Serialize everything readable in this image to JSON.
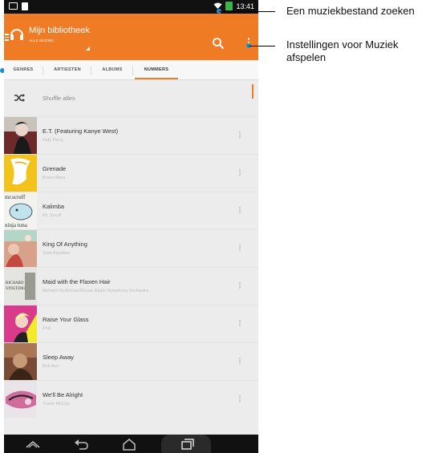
{
  "status_bar": {
    "time": "13:41"
  },
  "action_bar": {
    "title": "Mijn bibliotheek",
    "subtitle": "ALLE MUZIEK"
  },
  "tabs": [
    {
      "label": "GENRES",
      "active": false
    },
    {
      "label": "ARTIESTEN",
      "active": false
    },
    {
      "label": "ALBUMS",
      "active": false
    },
    {
      "label": "NUMMERS",
      "active": true
    }
  ],
  "shuffle": {
    "label": "Shuffle alles"
  },
  "songs": [
    {
      "title": "E.T. (Featuring Kanye West)",
      "artist": "Katy Perry"
    },
    {
      "title": "Grenade",
      "artist": "Bruno Mars"
    },
    {
      "title": "Kalimba",
      "artist": "Mr. Scruff"
    },
    {
      "title": "King Of Anything",
      "artist": "Sara Bareilles"
    },
    {
      "title": "Maid with the Flaxen Hair",
      "artist": "Richard Stoltzman/Slovak Radio Symphony Orchestra"
    },
    {
      "title": "Raise Your Glass",
      "artist": "Pink"
    },
    {
      "title": "Sleep Away",
      "artist": "Bob Acri"
    },
    {
      "title": "We'll Be Alright",
      "artist": "Travie McCoy"
    }
  ],
  "album_art_text": {
    "kalimba_top": "mr.scruff",
    "kalimba_bottom": "ninja tuna",
    "maid_line1": "RICHARD",
    "maid_line2": "STOLTZMAN"
  },
  "callouts": {
    "search": "Een muziekbestand zoeken",
    "settings_line1": "Instellingen voor Muziek",
    "settings_line2": "afspelen"
  },
  "colors": {
    "accent": "#ef7c25",
    "callout_dot": "#1c8fd0"
  }
}
